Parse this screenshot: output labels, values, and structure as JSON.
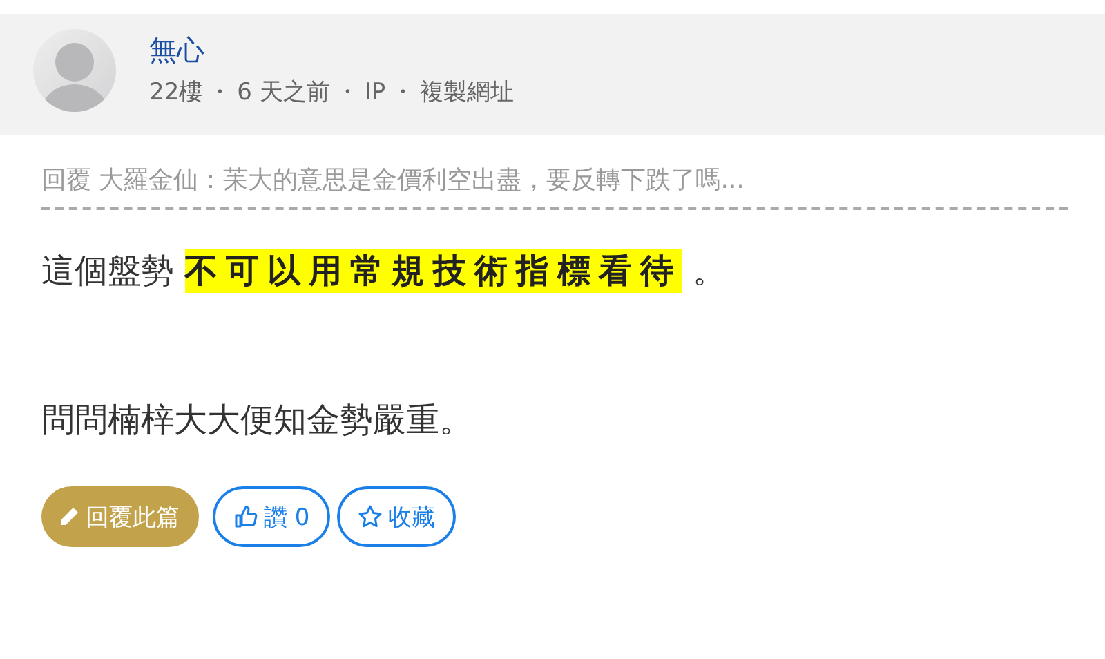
{
  "post": {
    "author": "無心",
    "meta": [
      "22樓",
      "6 天之前",
      "IP",
      "複製網址"
    ],
    "separator": "・",
    "reply_to": "回覆 大羅金仙：苿大的意思是金價利空出盡，要反轉下跌了嗎...",
    "paragraphs": [
      [
        {
          "text": "這個盤勢 ",
          "highlight": false
        },
        {
          "text": "不可以用常規技術指標看待",
          "highlight": true
        },
        {
          "text": " 。",
          "highlight": false
        }
      ],
      [
        {
          "text": "問問楠梓大大便知金勢嚴重。",
          "highlight": false
        }
      ]
    ],
    "buttons": [
      {
        "kind": "reply",
        "label": "回覆此篇"
      },
      {
        "kind": "like",
        "label": "讚 0"
      },
      {
        "kind": "favorite",
        "label": "收藏"
      }
    ]
  }
}
